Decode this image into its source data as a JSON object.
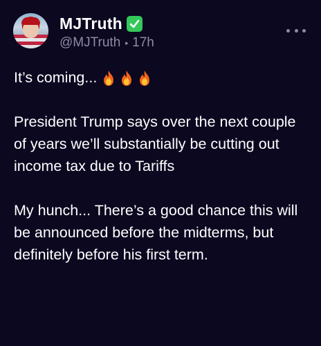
{
  "author": {
    "display_name": "MJTruth",
    "handle": "@MJTruth",
    "separator": "•",
    "time_ago": "17h",
    "verified_color": "#34c759"
  },
  "post": {
    "line1": "It’s coming...",
    "emoji": [
      "fire-emoji",
      "fire-emoji",
      "fire-emoji"
    ],
    "paragraph2": "President Trump says over the next couple of years we’ll substantially be cutting out income tax due to Tariffs",
    "paragraph3": "My hunch... There’s a good chance this will be announced before the midterms, but definitely before his first term."
  },
  "colors": {
    "background": "#0b0820",
    "secondary_text": "#8f8ba6",
    "primary_text": "#ffffff"
  }
}
